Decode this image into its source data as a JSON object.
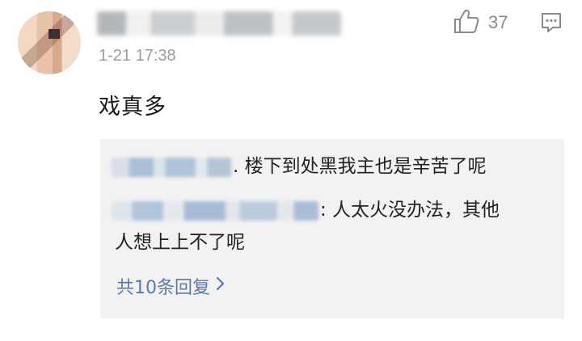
{
  "comment": {
    "timestamp": "1-21 17:38",
    "text": "戏真多",
    "like_count": "37",
    "like_icon": "thumbs-up-icon",
    "reply_icon": "comment-bubble-icon"
  },
  "replies": {
    "items": [
      {
        "text": ". 楼下到处黑我主也是辛苦了呢"
      },
      {
        "text": ": 人太火没办法，其他"
      },
      {
        "text": "人想上上不了呢"
      }
    ],
    "more_label": "共10条回复",
    "more_icon": "chevron-right-icon",
    "link_color": "#5b7aa7"
  }
}
